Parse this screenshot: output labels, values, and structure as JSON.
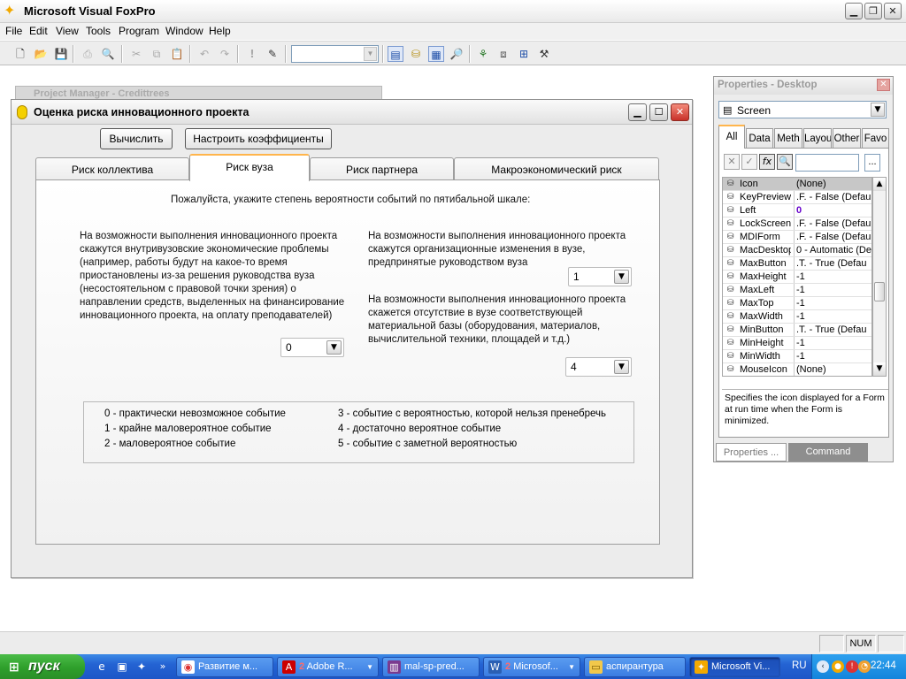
{
  "app": {
    "title": "Microsoft Visual FoxPro",
    "icon": "foxpro-icon"
  },
  "menu": [
    "File",
    "Edit",
    "View",
    "Tools",
    "Program",
    "Window",
    "Help"
  ],
  "background_window": {
    "title": "Project Manager - Credittrees"
  },
  "dialog": {
    "title": "Оценка риска инновационного проекта",
    "buttons": {
      "calculate": "Вычислить",
      "configure": "Настроить коэффициенты"
    },
    "tabs": [
      "Риск коллектива",
      "Риск вуза",
      "Риск партнера",
      "Макроэкономический риск"
    ],
    "active_tab": "Риск вуза",
    "instruction": "Пожалуйста, укажите степень вероятности событий по пятибальной шкале:",
    "questions": [
      {
        "text": "На возможности выполнения инновационного проекта скажутся внутривузовские экономические проблемы (например, работы будут на какое-то время приостановлены из-за решения руководства вуза (несостоятельном с правовой точки зрения) о направлении средств, выделенных на финансирование инновационного проекта, на оплату преподавателей)",
        "value": "0"
      },
      {
        "text": "На возможности выполнения инновационного проекта скажутся организационные изменения в вузе, предпринятые руководством вуза",
        "value": "1"
      },
      {
        "text": "На возможности выполнения инновационного проекта скажется отсутствие в вузе соответствующей материальной базы (оборудования, материалов, вычислительной техники, площадей и т.д.)",
        "value": "4"
      }
    ],
    "legend": [
      "0 - практически невозможное событие",
      "1 - крайне маловероятное событие",
      "2 - маловероятное событие",
      "3 - событие с вероятностью, которой нельзя пренебречь",
      "4 - достаточно вероятное событие",
      "5 - событие с заметной вероятностью"
    ]
  },
  "properties": {
    "title": "Properties - Desktop",
    "object": "Screen",
    "tabs": [
      "All",
      "Data",
      "Meth",
      "Layou",
      "Other",
      "Favo"
    ],
    "rows": [
      {
        "name": "Icon",
        "value": "(None)",
        "selected": true
      },
      {
        "name": "KeyPreview",
        "value": ".F. - False (Defau"
      },
      {
        "name": "Left",
        "value": "0",
        "highlight_color": "#6600cc"
      },
      {
        "name": "LockScreen",
        "value": ".F. - False (Defau"
      },
      {
        "name": "MDIForm",
        "value": ".F. - False (Defau"
      },
      {
        "name": "MacDesktop",
        "value": "0 - Automatic (De"
      },
      {
        "name": "MaxButton",
        "value": ".T. - True (Defau"
      },
      {
        "name": "MaxHeight",
        "value": "-1"
      },
      {
        "name": "MaxLeft",
        "value": "-1"
      },
      {
        "name": "MaxTop",
        "value": "-1"
      },
      {
        "name": "MaxWidth",
        "value": "-1"
      },
      {
        "name": "MinButton",
        "value": ".T. - True (Defau"
      },
      {
        "name": "MinHeight",
        "value": "-1"
      },
      {
        "name": "MinWidth",
        "value": "-1"
      },
      {
        "name": "MouseIcon",
        "value": "(None)"
      }
    ],
    "description": "Specifies the icon displayed for a Form at run time when the Form is minimized.",
    "bottom_tabs": [
      "Properties ...",
      "Command"
    ]
  },
  "statusbar": {
    "num": "NUM"
  },
  "taskbar": {
    "start": "пуск",
    "tasks": [
      {
        "label": "Развитие м...",
        "icon": "chrome-icon"
      },
      {
        "count": "2",
        "label": "Adobe R...",
        "icon": "pdf-icon"
      },
      {
        "label": "mal-sp-pred...",
        "icon": "winrar-icon"
      },
      {
        "count": "2",
        "label": "Microsof...",
        "icon": "word-icon"
      },
      {
        "label": "аспирантура",
        "icon": "folder-icon"
      },
      {
        "label": "Microsoft Vi...",
        "icon": "foxpro-icon",
        "active": true
      }
    ],
    "language": "RU",
    "clock": "22:44"
  },
  "colors": {
    "tab_accent": "#ffb54c",
    "taskbar_blue": "#2463d3",
    "start_green": "#2e9f2b",
    "close_red": "#c8312a"
  }
}
